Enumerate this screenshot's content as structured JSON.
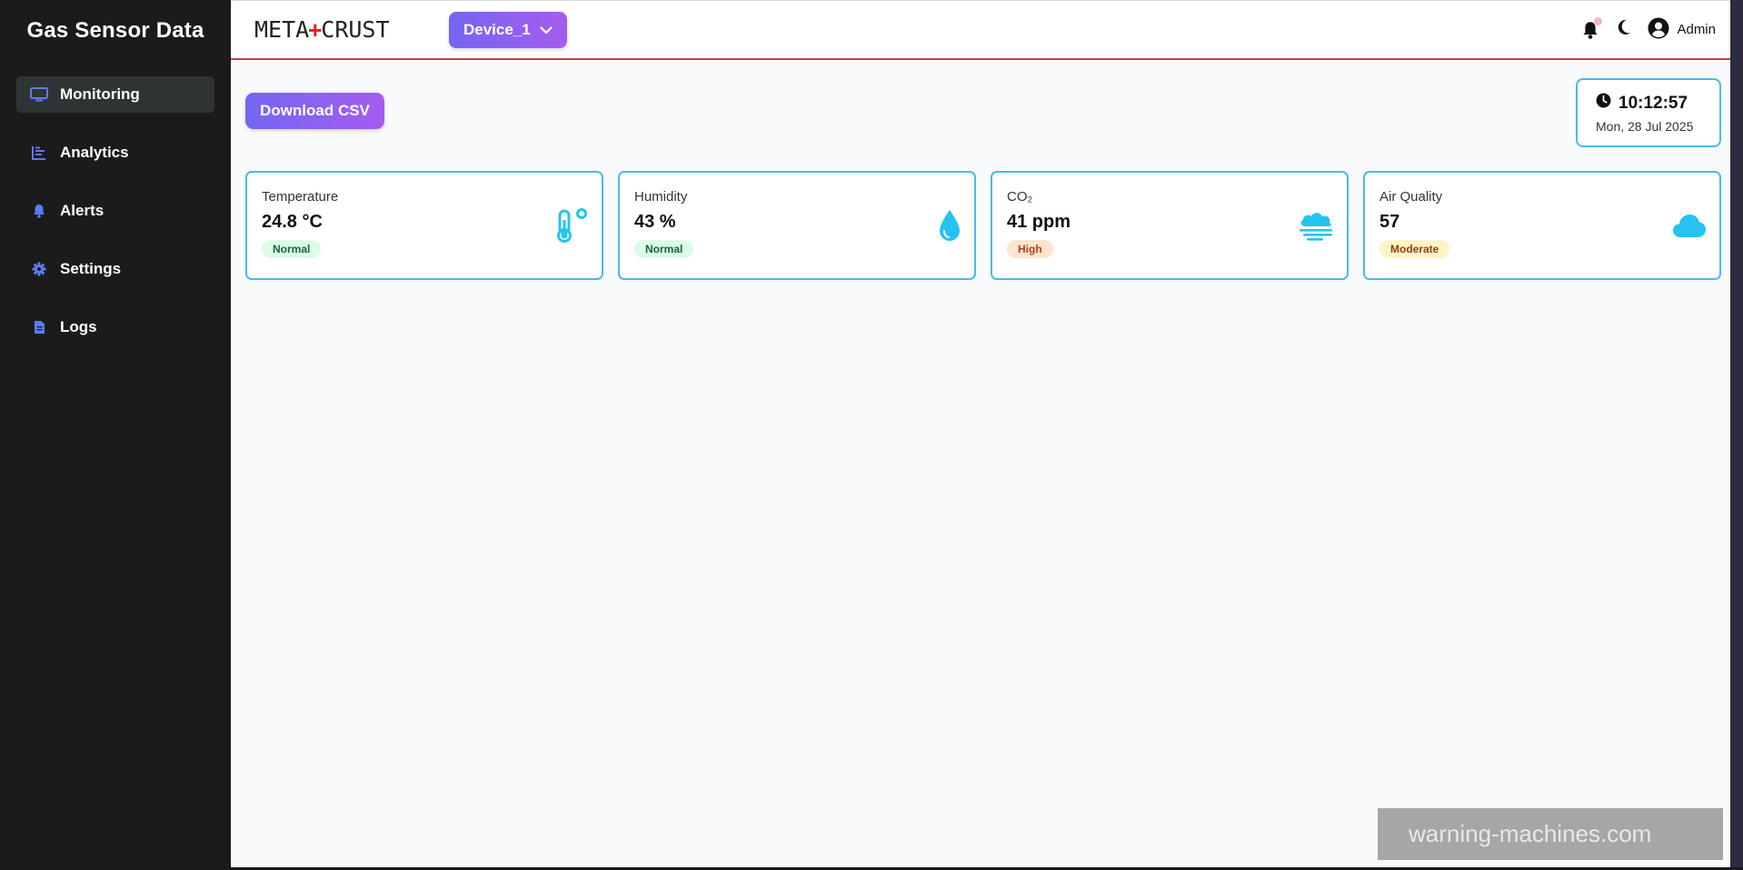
{
  "sidebar": {
    "title": "Gas Sensor Data",
    "items": [
      {
        "label": "Monitoring",
        "icon": "monitor-icon"
      },
      {
        "label": "Analytics",
        "icon": "chart-icon"
      },
      {
        "label": "Alerts",
        "icon": "bell-icon"
      },
      {
        "label": "Settings",
        "icon": "gear-icon"
      },
      {
        "label": "Logs",
        "icon": "file-icon"
      }
    ]
  },
  "header": {
    "logo_left": "META",
    "logo_plus": "+",
    "logo_right": "CRUST",
    "device": "Device_1",
    "user": "Admin"
  },
  "toolbar": {
    "download_label": "Download CSV"
  },
  "clock": {
    "time": "10:12:57",
    "date": "Mon, 28 Jul 2025"
  },
  "cards": [
    {
      "label": "Temperature",
      "value": "24.8 °C",
      "status": "Normal",
      "icon": "thermometer-icon"
    },
    {
      "label": "Humidity",
      "value": "43 %",
      "status": "Normal",
      "icon": "droplet-icon"
    },
    {
      "label": "CO₂",
      "value": "41 ppm",
      "status": "High",
      "icon": "smog-icon"
    },
    {
      "label": "Air Quality",
      "value": "57",
      "status": "Moderate",
      "icon": "cloud-icon"
    }
  ],
  "watermark": "warning-machines.com",
  "colors": {
    "accent_start": "#7466f2",
    "accent_end": "#a55cf0",
    "card_border": "#4cb9e6",
    "icon": "#26c3f0",
    "sidebar_bg": "#1b1b1b",
    "nav_icon": "#5b7cf0"
  }
}
